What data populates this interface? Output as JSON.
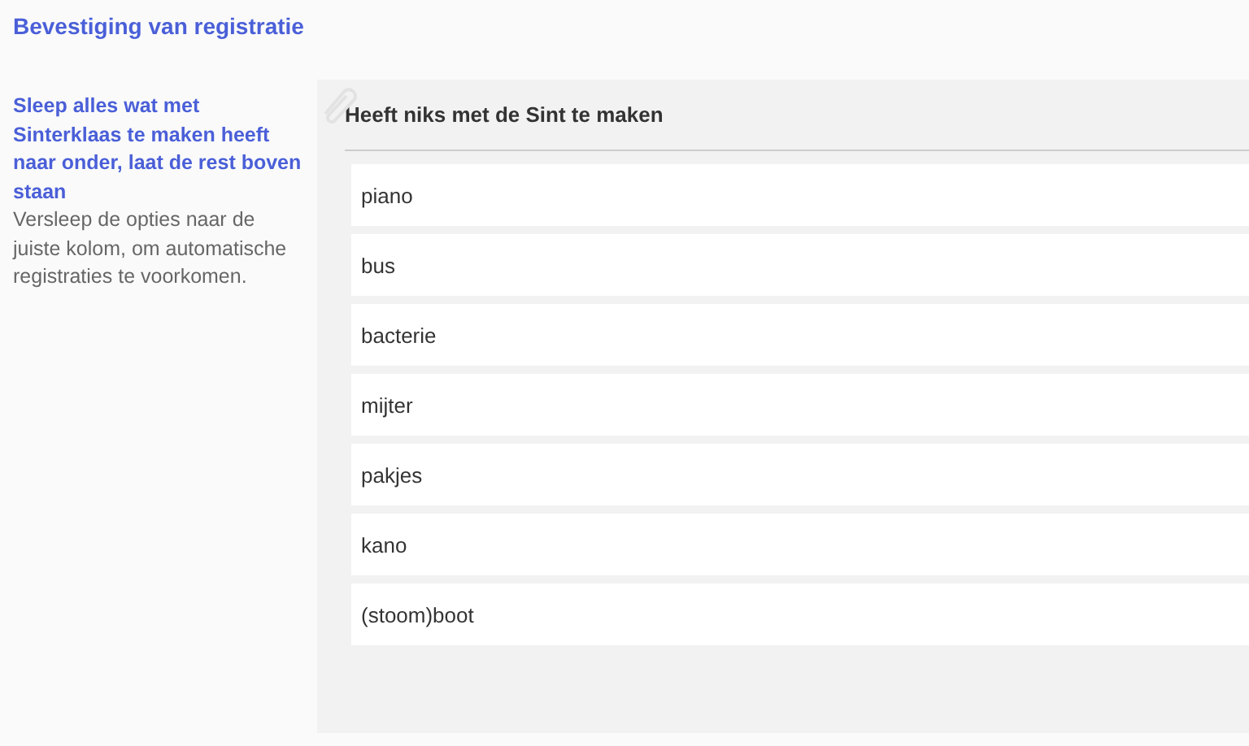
{
  "page_title": "Bevestiging van registratie",
  "instruction": {
    "heading": "Sleep alles wat met Sinterklaas te maken heeft naar onder, laat de rest boven staan",
    "text": "Versleep de opties naar de juiste kolom, om automatische registraties te voorkomen."
  },
  "column": {
    "title": "Heeft niks met de Sint te maken",
    "items": [
      {
        "label": "piano"
      },
      {
        "label": "bus"
      },
      {
        "label": "bacterie"
      },
      {
        "label": "mijter"
      },
      {
        "label": "pakjes"
      },
      {
        "label": "kano"
      },
      {
        "label": "(stoom)boot"
      }
    ]
  }
}
